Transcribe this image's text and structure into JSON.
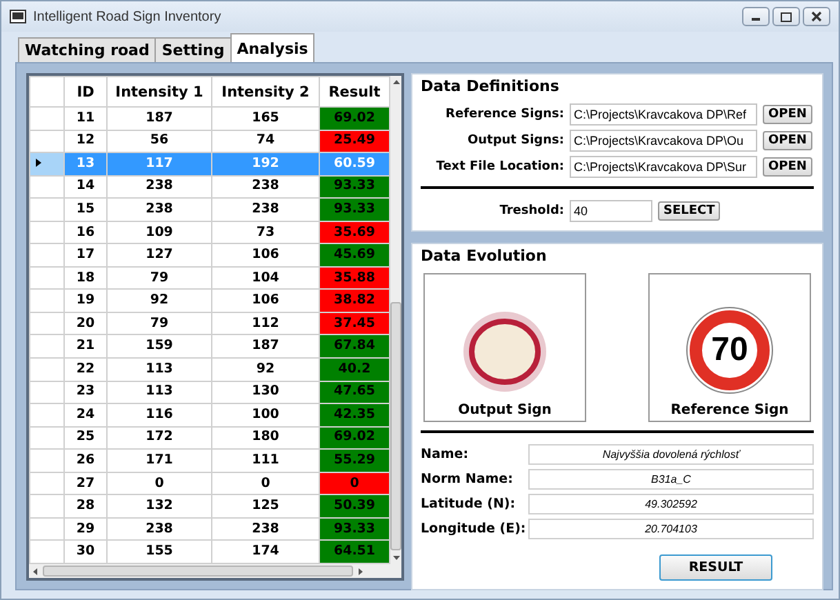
{
  "window": {
    "title": "Intelligent Road Sign Inventory"
  },
  "tabs": [
    {
      "label": "Watching road",
      "selected": false
    },
    {
      "label": "Setting",
      "selected": false
    },
    {
      "label": "Analysis",
      "selected": true
    }
  ],
  "table": {
    "columns": [
      "ID",
      "Intensity 1",
      "Intensity 2",
      "Result"
    ],
    "rows": [
      {
        "id": "11",
        "intensity_1": "187",
        "intensity_2": "165",
        "result": "69.02",
        "color": "#008000",
        "selected": false
      },
      {
        "id": "12",
        "intensity_1": "56",
        "intensity_2": "74",
        "result": "25.49",
        "color": "#ff0000",
        "selected": false
      },
      {
        "id": "13",
        "intensity_1": "117",
        "intensity_2": "192",
        "result": "60.59",
        "selected": true
      },
      {
        "id": "14",
        "intensity_1": "238",
        "intensity_2": "238",
        "result": "93.33",
        "color": "#008000",
        "selected": false
      },
      {
        "id": "15",
        "intensity_1": "238",
        "intensity_2": "238",
        "result": "93.33",
        "color": "#008000",
        "selected": false
      },
      {
        "id": "16",
        "intensity_1": "109",
        "intensity_2": "73",
        "result": "35.69",
        "color": "#ff0000",
        "selected": false
      },
      {
        "id": "17",
        "intensity_1": "127",
        "intensity_2": "106",
        "result": "45.69",
        "color": "#008000",
        "selected": false
      },
      {
        "id": "18",
        "intensity_1": "79",
        "intensity_2": "104",
        "result": "35.88",
        "color": "#ff0000",
        "selected": false
      },
      {
        "id": "19",
        "intensity_1": "92",
        "intensity_2": "106",
        "result": "38.82",
        "color": "#ff0000",
        "selected": false
      },
      {
        "id": "20",
        "intensity_1": "79",
        "intensity_2": "112",
        "result": "37.45",
        "color": "#ff0000",
        "selected": false
      },
      {
        "id": "21",
        "intensity_1": "159",
        "intensity_2": "187",
        "result": "67.84",
        "color": "#008000",
        "selected": false
      },
      {
        "id": "22",
        "intensity_1": "113",
        "intensity_2": "92",
        "result": "40.2",
        "color": "#008000",
        "selected": false
      },
      {
        "id": "23",
        "intensity_1": "113",
        "intensity_2": "130",
        "result": "47.65",
        "color": "#008000",
        "selected": false
      },
      {
        "id": "24",
        "intensity_1": "116",
        "intensity_2": "100",
        "result": "42.35",
        "color": "#008000",
        "selected": false
      },
      {
        "id": "25",
        "intensity_1": "172",
        "intensity_2": "180",
        "result": "69.02",
        "color": "#008000",
        "selected": false
      },
      {
        "id": "26",
        "intensity_1": "171",
        "intensity_2": "111",
        "result": "55.29",
        "color": "#008000",
        "selected": false
      },
      {
        "id": "27",
        "intensity_1": "0",
        "intensity_2": "0",
        "result": "0",
        "color": "#ff0000",
        "selected": false
      },
      {
        "id": "28",
        "intensity_1": "132",
        "intensity_2": "125",
        "result": "50.39",
        "color": "#008000",
        "selected": false
      },
      {
        "id": "29",
        "intensity_1": "238",
        "intensity_2": "238",
        "result": "93.33",
        "color": "#008000",
        "selected": false
      },
      {
        "id": "30",
        "intensity_1": "155",
        "intensity_2": "174",
        "result": "64.51",
        "color": "#008000",
        "selected": false
      }
    ]
  },
  "data_definitions": {
    "title": "Data Definitions",
    "paths": [
      {
        "label": "Reference Signs:",
        "value": "C:\\Projects\\Kravcakova DP\\Ref",
        "button": "OPEN"
      },
      {
        "label": "Output Signs:",
        "value": "C:\\Projects\\Kravcakova DP\\Ou",
        "button": "OPEN"
      },
      {
        "label": "Text File Location:",
        "value": "C:\\Projects\\Kravcakova DP\\Sur",
        "button": "OPEN"
      }
    ],
    "threshold": {
      "label": "Treshold:",
      "value": "40",
      "button": "SELECT"
    }
  },
  "data_evolution": {
    "title": "Data Evolution",
    "output_sign": {
      "caption": "Output Sign"
    },
    "reference_sign": {
      "caption": "Reference Sign",
      "number": "70"
    },
    "fields": [
      {
        "label": "Name:",
        "value": "Najvyššia dovolená rýchlosť"
      },
      {
        "label": "Norm Name:",
        "value": "B31a_C"
      },
      {
        "label": "Latitude (N):",
        "value": "49.302592"
      },
      {
        "label": "Longitude (E):",
        "value": "20.704103"
      }
    ],
    "button": "RESULT"
  }
}
